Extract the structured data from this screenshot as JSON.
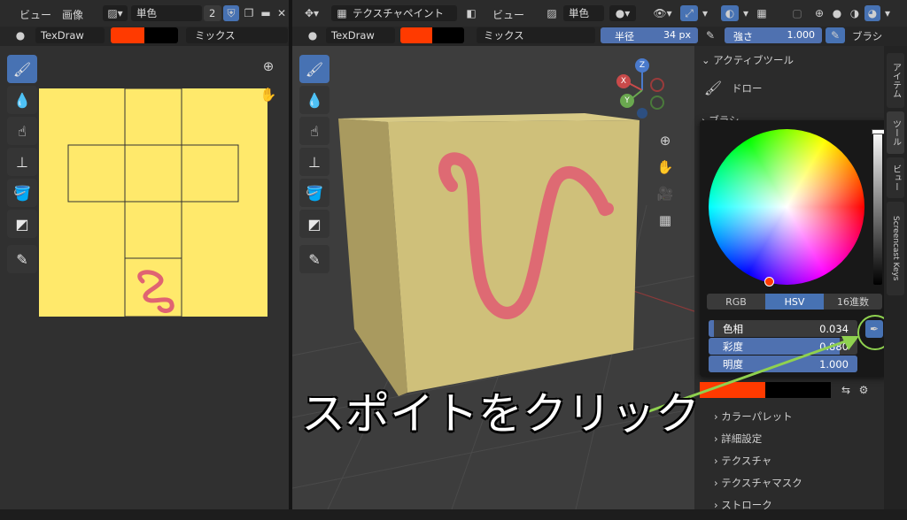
{
  "left_header": {
    "view": "ビュー",
    "image": "画像",
    "shading": "単色",
    "slot_count": "2"
  },
  "left_toolbar": {
    "brush": "TexDraw",
    "blend": "ミックス"
  },
  "main_header": {
    "mode": "テクスチャペイント",
    "view": "ビュー",
    "shading": "単色"
  },
  "main_toolbar": {
    "brush": "TexDraw",
    "blend": "ミックス",
    "radius_label": "半径",
    "radius_value": "34 px",
    "strength_label": "強さ",
    "strength_value": "1.000",
    "brush_menu": "ブラシ"
  },
  "side_panel": {
    "active_tool_title": "アクティブツール",
    "tool_name": "ドロー",
    "brush_section": "ブラシ"
  },
  "color_picker": {
    "tabs": [
      "RGB",
      "HSV",
      "16進数"
    ],
    "active_tab": "HSV",
    "hue_label": "色相",
    "hue_value": "0.034",
    "sat_label": "彩度",
    "sat_value": "0.880",
    "val_label": "明度",
    "val_value": "1.000",
    "hue_fraction": 0.034,
    "sat_fraction": 0.88,
    "val_fraction": 1.0
  },
  "collapsed_sections": [
    "カラーパレット",
    "詳細設定",
    "テクスチャ",
    "テクスチャマスク",
    "ストローク"
  ],
  "vertical_tabs": [
    "アイテム",
    "ツール",
    "ビュー",
    "Screencast Keys"
  ],
  "gizmo_axes": {
    "z": "Z",
    "x": "X",
    "y": "Y"
  },
  "annotation": "スポイトをクリック",
  "colors": {
    "primary": "#ff3a00",
    "secondary": "#000000",
    "accent": "#4772b3",
    "uv_fill": "#ffe96b",
    "cube": "#cfc07a",
    "stroke": "#e06372",
    "highlight": "#8fd14f"
  }
}
